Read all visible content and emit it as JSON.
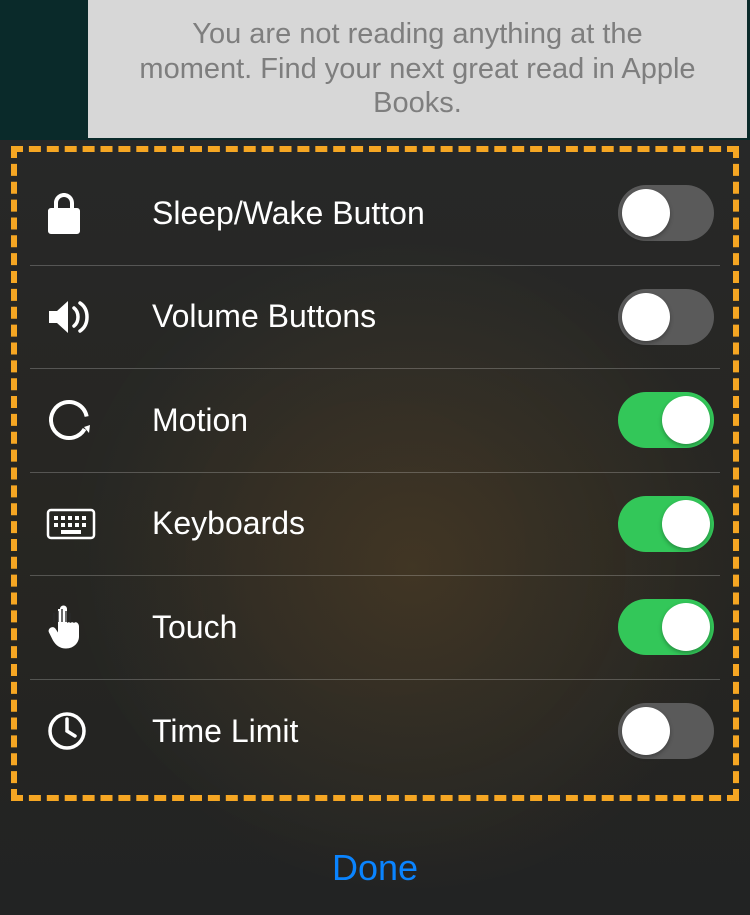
{
  "banner": {
    "text": "You are not reading anything at the moment. Find your next great read in Apple Books."
  },
  "colors": {
    "highlight_border": "#f5a623",
    "toggle_on": "#33c759",
    "toggle_off": "#5a5a5a",
    "done": "#0a84ff"
  },
  "options": [
    {
      "icon": "lock-icon",
      "label": "Sleep/Wake Button",
      "enabled": false
    },
    {
      "icon": "volume-icon",
      "label": "Volume Buttons",
      "enabled": false
    },
    {
      "icon": "motion-icon",
      "label": "Motion",
      "enabled": true
    },
    {
      "icon": "keyboard-icon",
      "label": "Keyboards",
      "enabled": true
    },
    {
      "icon": "touch-icon",
      "label": "Touch",
      "enabled": true
    },
    {
      "icon": "timer-icon",
      "label": "Time Limit",
      "enabled": false
    }
  ],
  "done_label": "Done"
}
